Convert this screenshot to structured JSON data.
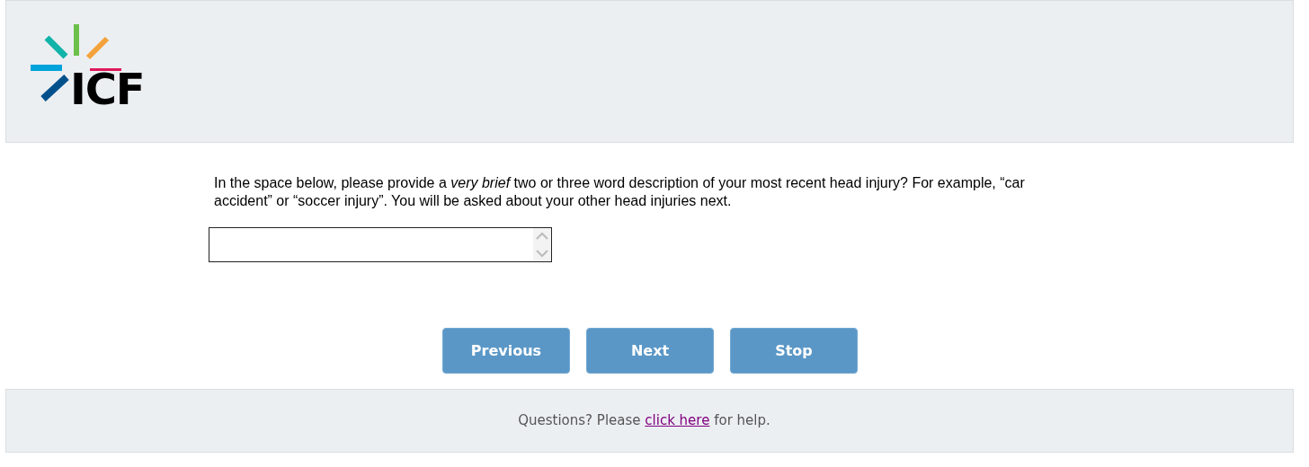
{
  "header": {
    "logo_text": "ICF"
  },
  "question": {
    "text": "In the space below, please provide a *very brief* two or three word description of your most recent head injury? For example, “car accident” or “soccer injury”. You will be asked about your other head injuries next."
  },
  "buttons": [
    {
      "label": "Previous"
    },
    {
      "label": "Next"
    },
    {
      "label": "Stop"
    }
  ],
  "footer": {
    "before": "Questions? Please ",
    "link": "click here",
    "after": " for help."
  }
}
